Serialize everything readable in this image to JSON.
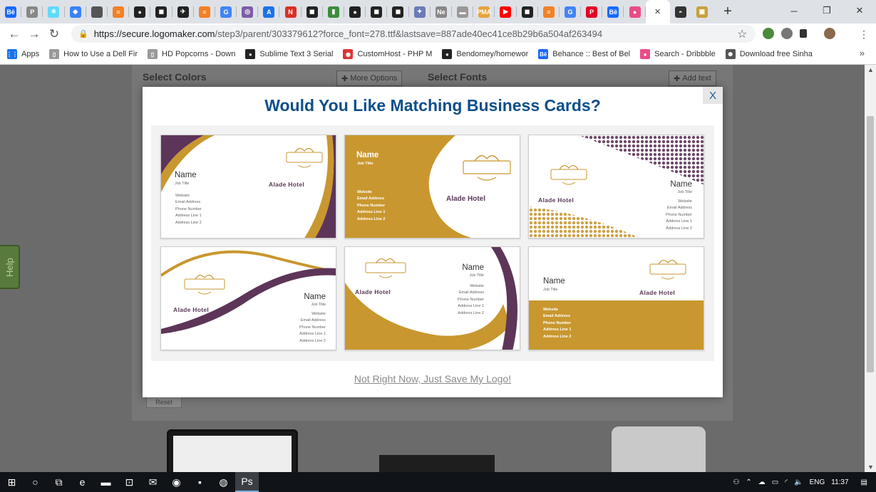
{
  "browser": {
    "tabs": [
      {
        "icon": "behance-icon",
        "glyph": "Bē",
        "color": "#1769ff"
      },
      {
        "icon": "pinterest-icon",
        "glyph": "P",
        "color": "#888"
      },
      {
        "icon": "react-icon",
        "glyph": "⚛",
        "color": "#61dafb"
      },
      {
        "icon": "pocket-icon",
        "glyph": "◆",
        "color": "#3b82f6"
      },
      {
        "icon": "apple-icon",
        "glyph": "",
        "color": "#555"
      },
      {
        "icon": "stackoverflow-icon",
        "glyph": "≡",
        "color": "#f48024"
      },
      {
        "icon": "github-icon",
        "glyph": "●",
        "color": "#222"
      },
      {
        "icon": "app-icon",
        "glyph": "◼",
        "color": "#222"
      },
      {
        "icon": "bird-icon",
        "glyph": "✈",
        "color": "#222"
      },
      {
        "icon": "stackoverflow-icon",
        "glyph": "≡",
        "color": "#f48024"
      },
      {
        "icon": "google-icon",
        "glyph": "G",
        "color": "#4285f4"
      },
      {
        "icon": "target-icon",
        "glyph": "◎",
        "color": "#7b5ea7"
      },
      {
        "icon": "angular-icon",
        "glyph": "A",
        "color": "#1a73e8"
      },
      {
        "icon": "news-icon",
        "glyph": "N",
        "color": "#d93025"
      },
      {
        "icon": "app-icon",
        "glyph": "◼",
        "color": "#222"
      },
      {
        "icon": "chart-icon",
        "glyph": "▮",
        "color": "#3c8d3c"
      },
      {
        "icon": "github-icon",
        "glyph": "●",
        "color": "#222"
      },
      {
        "icon": "app-icon",
        "glyph": "◼",
        "color": "#222"
      },
      {
        "icon": "app-icon",
        "glyph": "◼",
        "color": "#222"
      },
      {
        "icon": "compass-icon",
        "glyph": "✦",
        "color": "#6b7bb7"
      },
      {
        "icon": "ne-icon",
        "glyph": "Ne",
        "color": "#888",
        "text": "Ne"
      },
      {
        "icon": "card-icon",
        "glyph": "▬",
        "color": "#999"
      },
      {
        "icon": "pma-icon",
        "glyph": "PMA",
        "color": "#e8a33d"
      },
      {
        "icon": "youtube-icon",
        "glyph": "▶",
        "color": "#ff0000"
      },
      {
        "icon": "app-icon",
        "glyph": "◼",
        "color": "#222"
      },
      {
        "icon": "stackoverflow-icon",
        "glyph": "≡",
        "color": "#f48024"
      },
      {
        "icon": "google-icon",
        "glyph": "G",
        "color": "#4285f4"
      },
      {
        "icon": "pinterest-icon",
        "glyph": "P",
        "color": "#e60023"
      },
      {
        "icon": "behance-icon",
        "glyph": "Bē",
        "color": "#1769ff"
      },
      {
        "icon": "dribbble-icon",
        "glyph": "●",
        "color": "#ea4c89"
      }
    ],
    "active_tab_close": "×",
    "after_tabs": [
      {
        "icon": "incognito-icon",
        "glyph": "◓",
        "color": "#333"
      },
      {
        "icon": "image-icon",
        "glyph": "▣",
        "color": "#c8a03c"
      }
    ],
    "new_tab": "+",
    "window_controls": {
      "minimize": "─",
      "restore": "❐",
      "close": "✕"
    },
    "nav": {
      "back": "←",
      "forward": "→",
      "reload": "↻"
    },
    "url": {
      "host": "https://secure.logomaker.com",
      "path": "/step3/parent/303379612?force_font=278.ttf&lastsave=887ade40ec41ce8b29b6a504af263494"
    },
    "bookmarks": [
      {
        "label": "Apps",
        "icon": "apps-grid-icon",
        "color": "#1a73e8",
        "glyph": "⋮⋮"
      },
      {
        "label": "How to Use a Dell Fir",
        "icon": "page-icon",
        "color": "#999",
        "glyph": "▯"
      },
      {
        "label": "HD Popcorns - Down",
        "icon": "page-icon",
        "color": "#999",
        "glyph": "▯"
      },
      {
        "label": "Sublime Text 3 Serial",
        "icon": "github-icon",
        "color": "#222",
        "glyph": "●"
      },
      {
        "label": "CustomHost - PHP M",
        "icon": "host-icon",
        "color": "#d33",
        "glyph": "◉"
      },
      {
        "label": "Bendomey/homewor",
        "icon": "github-icon",
        "color": "#222",
        "glyph": "●"
      },
      {
        "label": "Behance :: Best of Bel",
        "icon": "behance-icon",
        "color": "#1769ff",
        "glyph": "Bē"
      },
      {
        "label": "Search - Dribbble",
        "icon": "dribbble-icon",
        "color": "#ea4c89",
        "glyph": "●"
      },
      {
        "label": "Download free Sinha",
        "icon": "sparkle-icon",
        "color": "#555",
        "glyph": "✺"
      }
    ],
    "bookmarks_more": "»"
  },
  "background": {
    "left_title": "Select Colors",
    "left_button": "More Options",
    "right_title": "Select Fonts",
    "right_button": "Add text",
    "reset": "Reset",
    "help": "Help"
  },
  "modal": {
    "close": "X",
    "title": "Would You Like Matching Business Cards?",
    "skip_link": "Not Right Now, Just Save My Logo!",
    "colors": {
      "gold": "#c9972f",
      "plum": "#5d3558",
      "title": "#0d4f8b"
    },
    "cards": [
      {
        "name": "Name",
        "job": "Job Title",
        "hotel": "Alade Hotel",
        "details": [
          "Website",
          "Email Address",
          "Phone Number",
          "Address Line 1",
          "Address Line 2"
        ]
      },
      {
        "name": "Name",
        "job": "Job Title",
        "hotel": "Alade Hotel",
        "details": [
          "Website",
          "Email Address",
          "Phone Number",
          "Address Line 1",
          "Address Line 2"
        ]
      },
      {
        "name": "Name",
        "job": "Job Title",
        "hotel": "Alade Hotel",
        "details": [
          "Website",
          "Email Address",
          "Phone Number",
          "Address Line 1",
          "Address Line 2"
        ]
      },
      {
        "name": "Name",
        "job": "Job Title",
        "hotel": "Alade Hotel",
        "details": [
          "Website",
          "Email Address",
          "Phone Number",
          "Address Line 1",
          "Address Line 2"
        ]
      },
      {
        "name": "Name",
        "job": "Job Title",
        "hotel": "Alade Hotel",
        "details": [
          "Website",
          "Email Address",
          "Phone Number",
          "Address Line 1",
          "Address Line 2"
        ]
      },
      {
        "name": "Name",
        "job": "Job Title",
        "hotel": "Alade Hotel",
        "details": [
          "Website",
          "Email Address",
          "Phone Number",
          "Address Line 1",
          "Address Line 2"
        ]
      }
    ]
  },
  "taskbar": {
    "apps": [
      {
        "icon": "windows-start-icon",
        "glyph": "⊞"
      },
      {
        "icon": "cortana-icon",
        "glyph": "○"
      },
      {
        "icon": "task-view-icon",
        "glyph": "⧉"
      },
      {
        "icon": "edge-icon",
        "glyph": "e"
      },
      {
        "icon": "file-explorer-icon",
        "glyph": "▬"
      },
      {
        "icon": "store-icon",
        "glyph": "⊡"
      },
      {
        "icon": "mail-icon",
        "glyph": "✉"
      },
      {
        "icon": "whatsapp-icon",
        "glyph": "◉"
      },
      {
        "icon": "sticky-notes-icon",
        "glyph": "▪"
      },
      {
        "icon": "chrome-icon",
        "glyph": "◍"
      },
      {
        "icon": "photoshop-icon",
        "glyph": "Ps"
      }
    ],
    "tray": {
      "people": "⚇",
      "chevron": "⌃",
      "cloud": "☁",
      "battery": "▭",
      "wifi": "◜",
      "volume": "🔈",
      "language": "ENG",
      "time": "11:37",
      "notifications": "▤"
    }
  }
}
